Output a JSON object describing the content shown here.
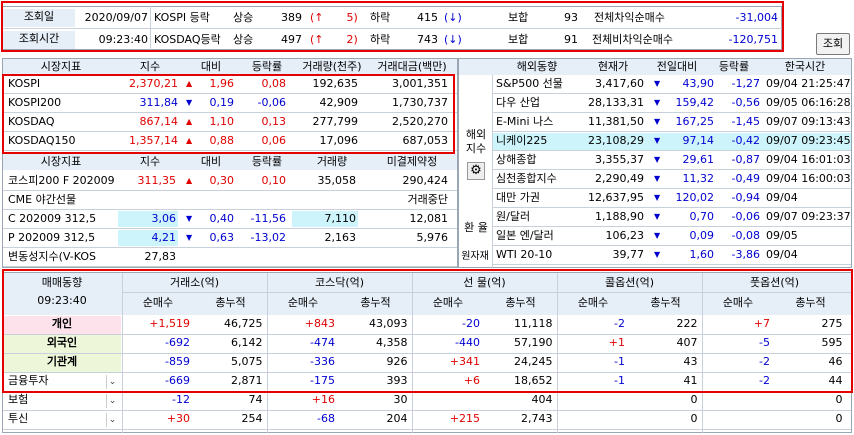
{
  "top": {
    "label_date": "조회일",
    "date": "2020/09/07",
    "label_time": "조회시간",
    "time": "09:23:40",
    "rows": [
      {
        "market": "KOSPI 등락",
        "up_lbl": "상승",
        "up": "389",
        "limit_up": "5",
        "down_lbl": "하락",
        "down": "415",
        "arrow_up": "↑",
        "arrow_down": "↓",
        "flat_lbl": "보합",
        "flat": "93",
        "diff_lbl": "전체차익순매수",
        "diff": "-31,004"
      },
      {
        "market": "KOSDAQ등락",
        "up_lbl": "상승",
        "up": "497",
        "limit_up": "2",
        "down_lbl": "하락",
        "down": "743",
        "arrow_up": "↑",
        "arrow_down": "↓",
        "flat_lbl": "보합",
        "flat": "91",
        "diff_lbl": "전체비차익순매수",
        "diff": "-120,751"
      }
    ],
    "query_button": "조회"
  },
  "market": {
    "headers": [
      "시장지표",
      "지수",
      "대비",
      "등락률",
      "거래량(천주)",
      "거래대금(백만)"
    ],
    "rows": [
      {
        "name": "KOSPI",
        "index": "2,370,21",
        "sign": "▲",
        "change": "1,96",
        "rate": "0,08",
        "volume": "192,635",
        "amount": "3,001,351",
        "color": "red"
      },
      {
        "name": "KOSPI200",
        "index": "311,84",
        "sign": "▼",
        "change": "0,19",
        "rate": "-0,06",
        "volume": "42,909",
        "amount": "1,730,737",
        "color": "blue"
      },
      {
        "name": "KOSDAQ",
        "index": "867,14",
        "sign": "▲",
        "change": "1,10",
        "rate": "0,13",
        "volume": "277,799",
        "amount": "2,520,270",
        "color": "red"
      },
      {
        "name": "KOSDAQ150",
        "index": "1,357,14",
        "sign": "▲",
        "change": "0,88",
        "rate": "0,06",
        "volume": "17,096",
        "amount": "687,053",
        "color": "red"
      }
    ]
  },
  "deriv": {
    "headers": [
      "시장지표",
      "지수",
      "대비",
      "등락률",
      "거래량",
      "미결제약정"
    ],
    "rows": [
      {
        "name": "코스피200 F 202009",
        "index": "311,35",
        "sign": "▲",
        "change": "0,30",
        "rate": "0,10",
        "volume": "35,058",
        "oi": "290,424"
      },
      {
        "name": "CME 야간선물",
        "index": "",
        "sign": "",
        "change": "",
        "rate": "",
        "volume": "",
        "oi": "거래중단"
      },
      {
        "name": "C 202009 312,5",
        "index": "3,06",
        "sign": "▼",
        "change": "0,40",
        "rate": "-11,56",
        "volume": "7,110",
        "oi": "12,081"
      },
      {
        "name": "P 202009 312,5",
        "index": "4,21",
        "sign": "▼",
        "change": "0,63",
        "rate": "-13,02",
        "volume": "2,163",
        "oi": "5,976"
      },
      {
        "name": "변동성지수(V-KOS",
        "index": "27,83",
        "sign": "",
        "change": "",
        "rate": "",
        "volume": "",
        "oi": ""
      }
    ]
  },
  "overseas": {
    "side_label_1": "해외",
    "side_label_2": "지수",
    "fx_label": "환 율",
    "raw_label": "원자재",
    "headers": [
      "해외동향",
      "현재가",
      "전일대비",
      "등락률",
      "한국시간"
    ],
    "rows": [
      {
        "name": "S&P500 선물",
        "price": "3,417,60",
        "sign": "▼",
        "change": "43,90",
        "rate": "-1,27",
        "time": "09/04 21:25:47"
      },
      {
        "name": "다우 산업",
        "price": "28,133,31",
        "sign": "▼",
        "change": "159,42",
        "rate": "-0,56",
        "time": "09/05 06:16:28"
      },
      {
        "name": "E-Mini 나스",
        "price": "11,381,50",
        "sign": "▼",
        "change": "167,25",
        "rate": "-1,45",
        "time": "09/07 09:13:43"
      },
      {
        "name": "니케이225",
        "price": "23,108,29",
        "sign": "▼",
        "change": "97,14",
        "rate": "-0,42",
        "time": "09/07 09:23:45"
      },
      {
        "name": "상해종합",
        "price": "3,355,37",
        "sign": "▼",
        "change": "29,61",
        "rate": "-0,87",
        "time": "09/04 16:01:03"
      },
      {
        "name": "심천종합지수",
        "price": "2,290,49",
        "sign": "▼",
        "change": "11,32",
        "rate": "-0,49",
        "time": "09/04 16:00:03"
      },
      {
        "name": "대만 가권",
        "price": "12,637,95",
        "sign": "▼",
        "change": "120,02",
        "rate": "-0,94",
        "time": "09/04"
      },
      {
        "name": "원/달러",
        "price": "1,188,90",
        "sign": "▼",
        "change": "0,70",
        "rate": "-0,06",
        "time": "09/07 09:23:37"
      },
      {
        "name": "일본 엔/달러",
        "price": "106,23",
        "sign": "▼",
        "change": "0,09",
        "rate": "-0,08",
        "time": "09/05"
      },
      {
        "name": "WTI 20-10",
        "price": "39,77",
        "sign": "▼",
        "change": "1,60",
        "rate": "-3,86",
        "time": "09/04"
      }
    ]
  },
  "trade": {
    "title": "매매동향",
    "time": "09:23:40",
    "groups": [
      "거래소(억)",
      "코스닥(억)",
      "선  물(억)",
      "콜옵션(억)",
      "풋옵션(억)"
    ],
    "sub": [
      "순매수",
      "총누적"
    ],
    "rows": [
      {
        "name": "개인",
        "v": [
          "+1,519",
          "46,725",
          "+843",
          "43,093",
          "-20",
          "11,118",
          "-2",
          "222",
          "+7",
          "275"
        ]
      },
      {
        "name": "외국인",
        "v": [
          "-692",
          "6,142",
          "-474",
          "4,358",
          "-440",
          "57,190",
          "+1",
          "407",
          "-5",
          "595"
        ]
      },
      {
        "name": "기관계",
        "v": [
          "-859",
          "5,075",
          "-336",
          "926",
          "+341",
          "24,245",
          "-1",
          "43",
          "-2",
          "46"
        ]
      },
      {
        "name": "금융투자",
        "v": [
          "-669",
          "2,871",
          "-175",
          "393",
          "+6",
          "18,652",
          "-1",
          "41",
          "-2",
          "44"
        ]
      },
      {
        "name": "보험",
        "v": [
          "-12",
          "74",
          "+16",
          "30",
          "",
          "404",
          "",
          "0",
          "",
          "0"
        ]
      },
      {
        "name": "투신",
        "v": [
          "+30",
          "254",
          "-68",
          "204",
          "+215",
          "2,743",
          "",
          "0",
          "",
          "0"
        ]
      }
    ]
  }
}
